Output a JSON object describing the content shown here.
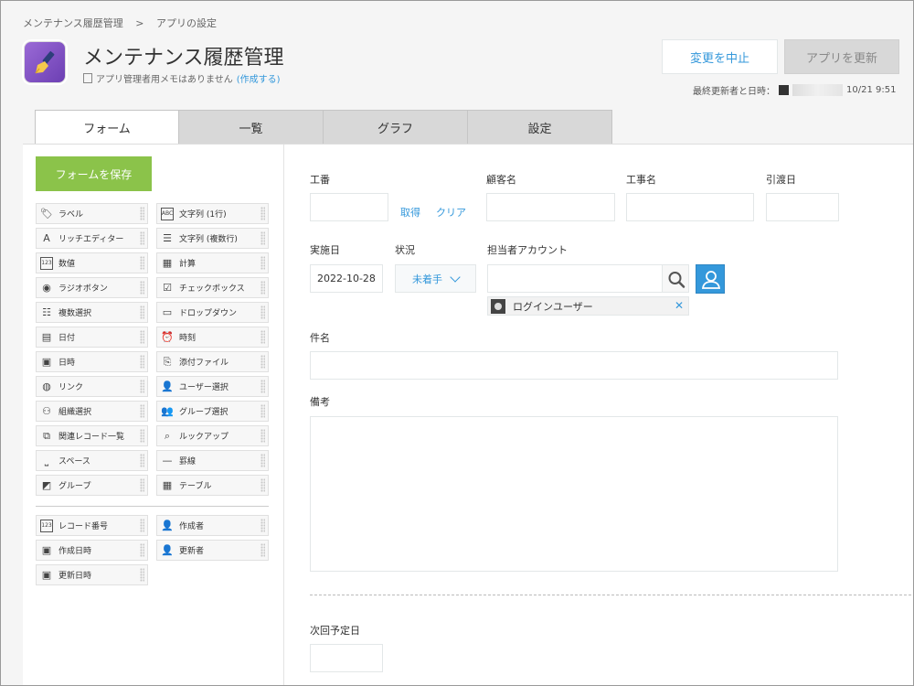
{
  "breadcrumb": [
    "メンテナンス履歴管理",
    ">",
    "アプリの設定"
  ],
  "app": {
    "title": "メンテナンス履歴管理",
    "memo": "アプリ管理者用メモはありません",
    "memo_link": "(作成する)"
  },
  "header": {
    "cancel_label": "変更を中止",
    "update_label": "アプリを更新",
    "updated_label": "最終更新者と日時：",
    "updated_time": "10/21 9:51"
  },
  "tabs": [
    "フォーム",
    "一覧",
    "グラフ",
    "設定"
  ],
  "palette": {
    "save_label": "フォームを保存",
    "items": [
      {
        "label": "ラベル",
        "icon": "tag-icon"
      },
      {
        "label": "文字列 (1行)",
        "icon": "abc-icon"
      },
      {
        "label": "リッチエディター",
        "icon": "letter-a-icon"
      },
      {
        "label": "文字列 (複数行)",
        "icon": "multiline-icon"
      },
      {
        "label": "数値",
        "icon": "number-icon"
      },
      {
        "label": "計算",
        "icon": "calculator-icon"
      },
      {
        "label": "ラジオボタン",
        "icon": "radio-icon"
      },
      {
        "label": "チェックボックス",
        "icon": "checkbox-icon"
      },
      {
        "label": "複数選択",
        "icon": "list-icon"
      },
      {
        "label": "ドロップダウン",
        "icon": "dropdown-icon"
      },
      {
        "label": "日付",
        "icon": "date-icon"
      },
      {
        "label": "時刻",
        "icon": "clock-icon"
      },
      {
        "label": "日時",
        "icon": "calendar-icon"
      },
      {
        "label": "添付ファイル",
        "icon": "paperclip-icon"
      },
      {
        "label": "リンク",
        "icon": "globe-icon"
      },
      {
        "label": "ユーザー選択",
        "icon": "user-icon"
      },
      {
        "label": "組織選択",
        "icon": "org-icon"
      },
      {
        "label": "グループ選択",
        "icon": "group-icon"
      },
      {
        "label": "関連レコード一覧",
        "icon": "related-icon"
      },
      {
        "label": "ルックアップ",
        "icon": "lookup-icon"
      },
      {
        "label": "スペース",
        "icon": "space-icon"
      },
      {
        "label": "罫線",
        "icon": "line-icon"
      },
      {
        "label": "グループ",
        "icon": "folder-icon"
      },
      {
        "label": "テーブル",
        "icon": "table-icon"
      }
    ],
    "system_items": [
      {
        "label": "レコード番号",
        "icon": "number-icon"
      },
      {
        "label": "作成者",
        "icon": "user-icon"
      },
      {
        "label": "作成日時",
        "icon": "calendar-icon"
      },
      {
        "label": "更新者",
        "icon": "user-icon"
      },
      {
        "label": "更新日時",
        "icon": "calendar-icon"
      }
    ]
  },
  "form": {
    "kouban_label": "工番",
    "get_link": "取得",
    "clear_link": "クリア",
    "customer_label": "顧客名",
    "work_label": "工事名",
    "delivery_label": "引渡日",
    "impl_date_label": "実施日",
    "impl_date_value": "2022-10-28",
    "status_label": "状況",
    "status_value": "未着手",
    "account_label": "担当者アカウント",
    "account_user": "ログインユーザー",
    "subject_label": "件名",
    "notes_label": "備考",
    "next_date_label": "次回予定日"
  },
  "colors": {
    "accent": "#3498db",
    "save_green": "#8bc34a",
    "app_icon": "#8e5cd0"
  }
}
